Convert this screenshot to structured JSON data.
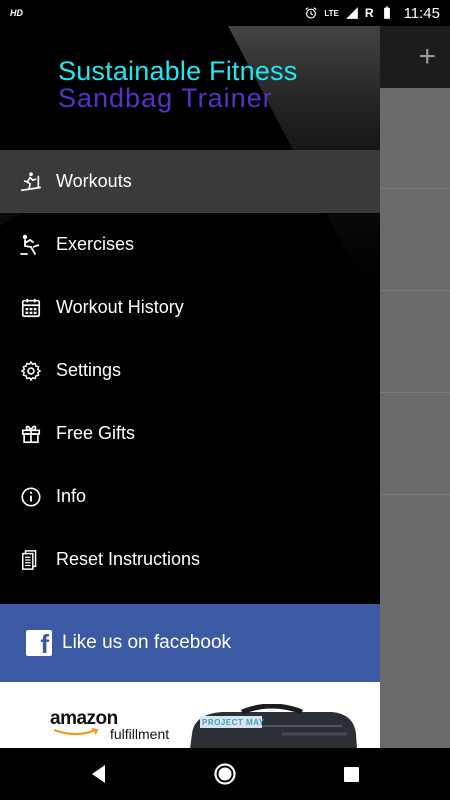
{
  "status_bar": {
    "hd_badge": "HD",
    "network": "LTE",
    "roaming": "R",
    "time": "11:45",
    "icons": [
      "alarm-icon",
      "signal-icon",
      "battery-icon"
    ]
  },
  "background_app": {
    "add_icon": "plus-icon"
  },
  "drawer": {
    "title_line1": "Sustainable Fitness",
    "title_line2": "Sandbag Trainer",
    "items": [
      {
        "label": "Workouts",
        "icon": "treadmill-icon",
        "active": true
      },
      {
        "label": "Exercises",
        "icon": "exercise-icon",
        "active": false
      },
      {
        "label": "Workout History",
        "icon": "calendar-icon",
        "active": false
      },
      {
        "label": "Settings",
        "icon": "gear-icon",
        "active": false
      },
      {
        "label": "Free Gifts",
        "icon": "gift-icon",
        "active": false
      },
      {
        "label": "Info",
        "icon": "info-icon",
        "active": false
      },
      {
        "label": "Reset Instructions",
        "icon": "documents-icon",
        "active": false
      }
    ],
    "facebook": {
      "label": "Like us on facebook",
      "icon": "facebook-icon"
    },
    "ad": {
      "brand": "amazon",
      "tagline": "fulfillment",
      "product_text": "PROJECT MAY"
    }
  },
  "colors": {
    "title_line1": "#20e8f0",
    "title_line2": "#5a2fc8",
    "facebook": "#3b5aa3",
    "active_item": "#3a3a3a"
  }
}
